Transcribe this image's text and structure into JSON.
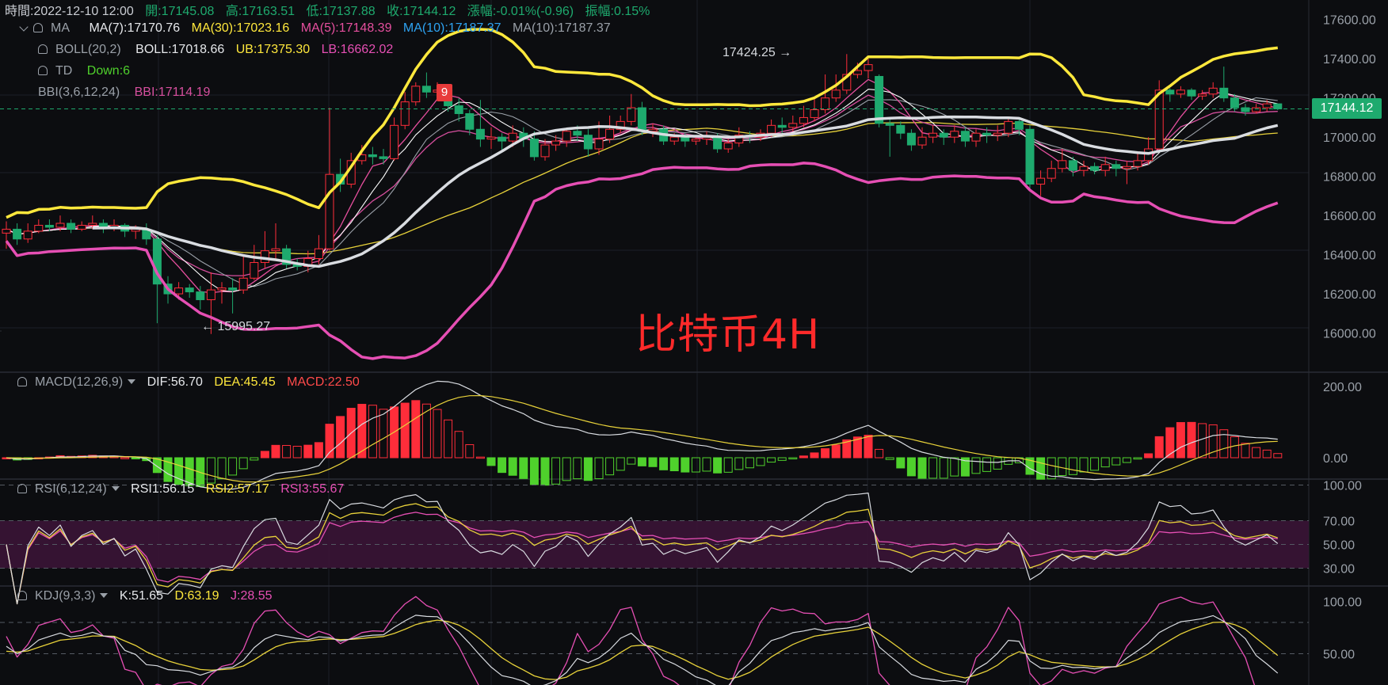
{
  "header": {
    "time_label": "時間:2022-12-10 12:00",
    "open_label": "開:17145.08",
    "high_label": "高:17163.51",
    "low_label": "低:17137.88",
    "close_label": "收:17144.12",
    "change_label": "漲幅:-0.01%(-0.96)",
    "amplitude_label": "振幅:0.15%"
  },
  "legend": {
    "ma": {
      "name": "MA",
      "ma7": "MA(7):17170.76",
      "ma30": "MA(30):17023.16",
      "ma5": "MA(5):17148.39",
      "ma10a": "MA(10):17187.37",
      "ma10b": "MA(10):17187.37"
    },
    "boll": {
      "name": "BOLL(20,2)",
      "mid": "BOLL:17018.66",
      "ub": "UB:17375.30",
      "lb": "LB:16662.02"
    },
    "td": {
      "name": "TD",
      "value": "Down:6"
    },
    "bbi": {
      "name": "BBI(3,6,12,24)",
      "value": "BBI:17114.19"
    },
    "macd": {
      "name": "MACD(12,26,9)",
      "dif": "DIF:56.70",
      "dea": "DEA:45.45",
      "macd": "MACD:22.50"
    },
    "rsi": {
      "name": "RSI(6,12,24)",
      "rsi1": "RSI1:56.15",
      "rsi2": "RSI2:57.17",
      "rsi3": "RSI3:55.67"
    },
    "kdj": {
      "name": "KDJ(9,3,3)",
      "k": "K:51.65",
      "d": "D:63.19",
      "j": "J:28.55"
    }
  },
  "annotations": {
    "high_marker": "17424.25 →",
    "low_marker": "← 15995.27",
    "td_count": "9",
    "watermark": "比特币4H",
    "current_price": "17144.12"
  },
  "colors": {
    "up": "#1eaa6e",
    "down": "#ff2d3a",
    "boll_band": "#ffe83c",
    "boll_lower": "#e64fb4",
    "boll_mid": "#d9dce1",
    "ma7": "#ffffff",
    "ma30": "#e8d23a",
    "ma5": "#e64f9e",
    "ma10": "#2ea3f2",
    "bbi": "#d64f9e",
    "macd_pos": "#ff2d3a",
    "macd_neg": "#4fd12c",
    "dif": "#d9dce1",
    "dea": "#e8d23a",
    "rsi1": "#d9dce1",
    "rsi2": "#e8d23a",
    "rsi3": "#e64fb4"
  },
  "chart_data": [
    {
      "type": "candlestick",
      "title": "比特币4H",
      "ylim": [
        15800,
        17700
      ],
      "yticks": [
        16000,
        16200,
        16400,
        16600,
        16800,
        17000,
        17200,
        17400,
        17600
      ],
      "ytick_labels": [
        "16000.00",
        "16200.00",
        "16400.00",
        "16600.00",
        "16800.00",
        "17000.00",
        "17200.00",
        "17400.00",
        "17600.00"
      ],
      "current_price": 17144.12,
      "candles": [
        [
          16510,
          16530,
          16430,
          16570
        ],
        [
          16530,
          16480,
          16450,
          16560
        ],
        [
          16480,
          16520,
          16460,
          16560
        ],
        [
          16520,
          16550,
          16510,
          16580
        ],
        [
          16550,
          16540,
          16520,
          16580
        ],
        [
          16540,
          16560,
          16520,
          16600
        ],
        [
          16560,
          16530,
          16510,
          16580
        ],
        [
          16530,
          16550,
          16520,
          16570
        ],
        [
          16550,
          16560,
          16530,
          16600
        ],
        [
          16560,
          16540,
          16510,
          16580
        ],
        [
          16540,
          16550,
          16520,
          16580
        ],
        [
          16550,
          16520,
          16490,
          16560
        ],
        [
          16520,
          16530,
          16480,
          16550
        ],
        [
          16530,
          16480,
          16450,
          16560
        ],
        [
          16480,
          16250,
          16050,
          16500
        ],
        [
          16250,
          16200,
          16150,
          16290
        ],
        [
          16200,
          16230,
          16170,
          16260
        ],
        [
          16230,
          16210,
          16180,
          16250
        ],
        [
          16210,
          16170,
          16120,
          16240
        ],
        [
          16170,
          16220,
          15995,
          16310
        ],
        [
          16220,
          16230,
          16150,
          16260
        ],
        [
          16230,
          16220,
          16100,
          16280
        ],
        [
          16220,
          16280,
          16200,
          16400
        ],
        [
          16280,
          16360,
          16270,
          16450
        ],
        [
          16360,
          16420,
          16330,
          16520
        ],
        [
          16420,
          16430,
          16380,
          16560
        ],
        [
          16430,
          16350,
          16330,
          16450
        ],
        [
          16350,
          16340,
          16320,
          16380
        ],
        [
          16340,
          16380,
          16310,
          16420
        ],
        [
          16380,
          16430,
          16350,
          16500
        ],
        [
          16430,
          16810,
          16420,
          17150
        ],
        [
          16810,
          16760,
          16720,
          16890
        ],
        [
          16760,
          16880,
          16740,
          16920
        ],
        [
          16880,
          16910,
          16860,
          16960
        ],
        [
          16910,
          16900,
          16860,
          16950
        ],
        [
          16900,
          16890,
          16860,
          16940
        ],
        [
          16890,
          17060,
          16880,
          17100
        ],
        [
          17060,
          17180,
          17040,
          17230
        ],
        [
          17180,
          17260,
          17160,
          17280
        ],
        [
          17260,
          17230,
          17200,
          17330
        ],
        [
          17230,
          17240,
          17200,
          17280
        ],
        [
          17240,
          17160,
          17130,
          17260
        ],
        [
          17160,
          17120,
          17080,
          17200
        ],
        [
          17120,
          17040,
          17010,
          17140
        ],
        [
          17040,
          16990,
          16950,
          17190
        ],
        [
          16990,
          17000,
          16940,
          17050
        ],
        [
          17000,
          16980,
          16930,
          17020
        ],
        [
          16980,
          17020,
          16950,
          17060
        ],
        [
          17020,
          16990,
          16950,
          17050
        ],
        [
          16990,
          16900,
          16880,
          17030
        ],
        [
          16900,
          16960,
          16880,
          16990
        ],
        [
          16960,
          16980,
          16930,
          17010
        ],
        [
          16980,
          17030,
          16950,
          17040
        ],
        [
          17030,
          17010,
          16980,
          17060
        ],
        [
          17010,
          16940,
          16900,
          17040
        ],
        [
          16940,
          16990,
          16910,
          17080
        ],
        [
          16990,
          17040,
          16970,
          17110
        ],
        [
          17040,
          17080,
          17020,
          17110
        ],
        [
          17080,
          17150,
          17060,
          17220
        ],
        [
          17150,
          17030,
          17010,
          17180
        ],
        [
          17030,
          17040,
          17000,
          17070
        ],
        [
          17040,
          16980,
          16960,
          17060
        ],
        [
          16980,
          17000,
          16960,
          17020
        ],
        [
          17000,
          16980,
          16950,
          17020
        ],
        [
          16980,
          16990,
          16960,
          17010
        ],
        [
          16990,
          17000,
          16960,
          17030
        ],
        [
          17000,
          16940,
          16920,
          17020
        ],
        [
          16940,
          16970,
          16920,
          16990
        ],
        [
          16970,
          17010,
          16950,
          17050
        ],
        [
          17010,
          17000,
          16970,
          17030
        ],
        [
          17000,
          17020,
          16980,
          17040
        ],
        [
          17020,
          17060,
          17000,
          17090
        ],
        [
          17060,
          17050,
          17020,
          17100
        ],
        [
          17050,
          17070,
          17030,
          17110
        ],
        [
          17070,
          17100,
          17050,
          17160
        ],
        [
          17100,
          17140,
          17080,
          17200
        ],
        [
          17140,
          17200,
          17120,
          17320
        ],
        [
          17200,
          17240,
          17180,
          17320
        ],
        [
          17240,
          17320,
          17220,
          17424
        ],
        [
          17320,
          17340,
          17300,
          17380
        ],
        [
          17340,
          17370,
          17300,
          17400
        ],
        [
          17310,
          17070,
          17050,
          17320
        ],
        [
          17070,
          17060,
          16900,
          17100
        ],
        [
          17060,
          17020,
          16990,
          17080
        ],
        [
          17020,
          16960,
          16930,
          17040
        ],
        [
          16960,
          17000,
          16940,
          17050
        ],
        [
          17000,
          17020,
          16970,
          17060
        ],
        [
          17020,
          17000,
          16960,
          17040
        ],
        [
          17000,
          17030,
          16970,
          17060
        ],
        [
          17030,
          16980,
          16950,
          17050
        ],
        [
          16980,
          17020,
          16950,
          17040
        ],
        [
          17020,
          17010,
          16970,
          17050
        ],
        [
          17010,
          17020,
          16980,
          17060
        ],
        [
          17020,
          17080,
          17000,
          17100
        ],
        [
          17080,
          17040,
          17010,
          17100
        ],
        [
          17040,
          16760,
          16740,
          17060
        ],
        [
          16760,
          16790,
          16700,
          16830
        ],
        [
          16790,
          16840,
          16770,
          16880
        ],
        [
          16840,
          16880,
          16820,
          16940
        ],
        [
          16880,
          16830,
          16800,
          16900
        ],
        [
          16830,
          16850,
          16800,
          16880
        ],
        [
          16850,
          16830,
          16810,
          16870
        ],
        [
          16830,
          16860,
          16800,
          16900
        ],
        [
          16860,
          16840,
          16800,
          16880
        ],
        [
          16840,
          16850,
          16760,
          16880
        ],
        [
          16850,
          16880,
          16830,
          16920
        ],
        [
          16880,
          16940,
          16860,
          17000
        ],
        [
          16940,
          17240,
          16930,
          17290
        ],
        [
          17240,
          17220,
          17180,
          17250
        ],
        [
          17220,
          17240,
          17200,
          17260
        ],
        [
          17240,
          17210,
          17190,
          17250
        ],
        [
          17210,
          17220,
          17190,
          17240
        ],
        [
          17220,
          17250,
          17200,
          17280
        ],
        [
          17250,
          17200,
          17180,
          17360
        ],
        [
          17200,
          17150,
          17130,
          17220
        ],
        [
          17150,
          17130,
          17110,
          17170
        ],
        [
          17130,
          17150,
          17120,
          17170
        ],
        [
          17150,
          17170,
          17130,
          17190
        ],
        [
          17170,
          17144,
          17138,
          17164
        ]
      ]
    },
    {
      "type": "bar",
      "title": "MACD(12,26,9)",
      "ylim": [
        -60,
        240
      ],
      "yticks": [
        0,
        200
      ],
      "ytick_labels": [
        "0.00",
        "200.00"
      ]
    },
    {
      "type": "line",
      "title": "RSI(6,12,24)",
      "ylim": [
        15,
        105
      ],
      "yticks": [
        30,
        50,
        70,
        100
      ],
      "ytick_labels": [
        "30.00",
        "50.00",
        "70.00",
        "100.00"
      ],
      "band": [
        30,
        70
      ]
    },
    {
      "type": "line",
      "title": "KDJ(9,3,3)",
      "ylim": [
        20,
        115
      ],
      "yticks": [
        50,
        100
      ],
      "ytick_labels": [
        "50.00",
        "100.00"
      ]
    }
  ]
}
